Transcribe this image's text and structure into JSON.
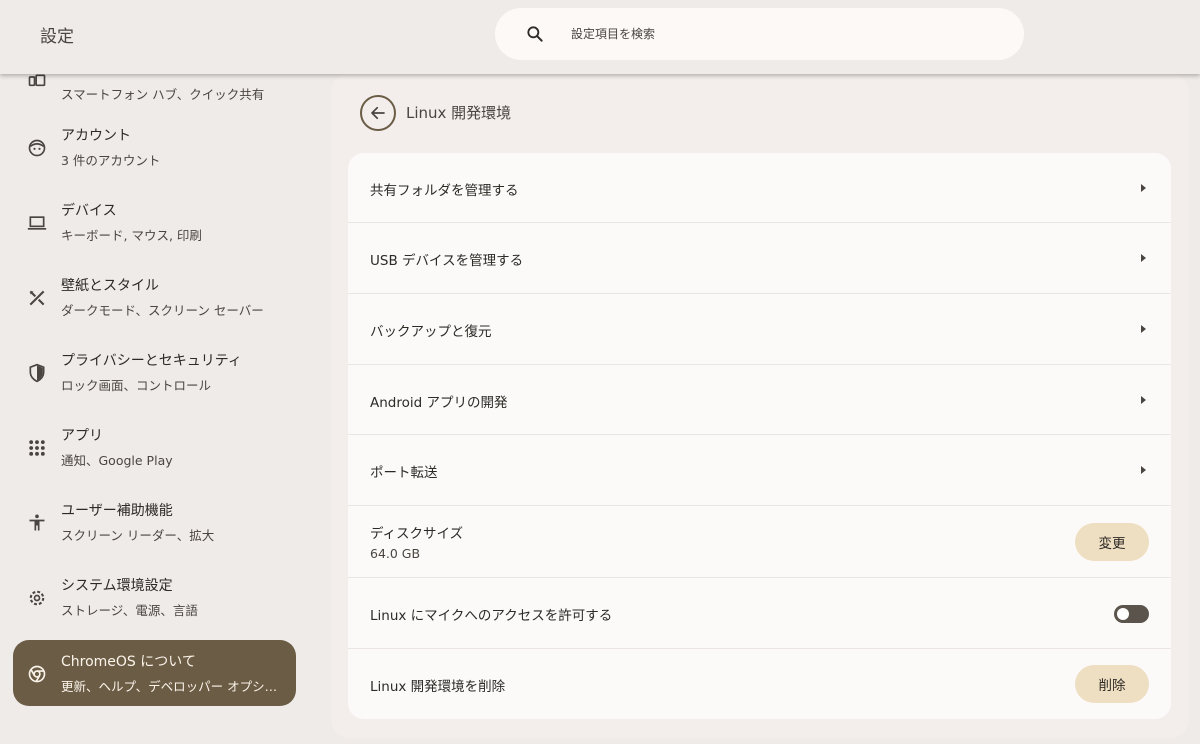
{
  "header": {
    "title": "設定",
    "search": {
      "placeholder": "設定項目を検索",
      "value": ""
    }
  },
  "sidebar": {
    "items": [
      {
        "title": "",
        "subtitle": "スマートフォン ハブ、クイック共有",
        "icon": "devices-icon"
      },
      {
        "title": "アカウント",
        "subtitle": "3 件のアカウント",
        "icon": "face-icon"
      },
      {
        "title": "デバイス",
        "subtitle": "キーボード, マウス, 印刷",
        "icon": "laptop-icon"
      },
      {
        "title": "壁紙とスタイル",
        "subtitle": "ダークモード、スクリーン セーバー",
        "icon": "palette-brush-icon"
      },
      {
        "title": "プライバシーとセキュリティ",
        "subtitle": "ロック画面、コントロール",
        "icon": "shield-icon"
      },
      {
        "title": "アプリ",
        "subtitle": "通知、Google Play",
        "icon": "apps-grid-icon"
      },
      {
        "title": "ユーザー補助機能",
        "subtitle": "スクリーン リーダー、拡大",
        "icon": "accessibility-icon"
      },
      {
        "title": "システム環境設定",
        "subtitle": "ストレージ、電源、言語",
        "icon": "settings-gear-icon"
      },
      {
        "title": "ChromeOS について",
        "subtitle": "更新、ヘルプ、デベロッパー オプション",
        "icon": "chrome-icon",
        "active": true
      }
    ]
  },
  "main": {
    "title": "Linux 開発環境",
    "rows": [
      {
        "label": "共有フォルダを管理する",
        "type": "link"
      },
      {
        "label": "USB デバイスを管理する",
        "type": "link"
      },
      {
        "label": "バックアップと復元",
        "type": "link"
      },
      {
        "label": "Android アプリの開発",
        "type": "link"
      },
      {
        "label": "ポート転送",
        "type": "link"
      },
      {
        "label": "ディスクサイズ",
        "sublabel": "64.0 GB",
        "type": "button",
        "button_label": "変更"
      },
      {
        "label": "Linux にマイクへのアクセスを許可する",
        "type": "toggle",
        "toggle_on": false
      },
      {
        "label": "Linux 開発環境を削除",
        "type": "button",
        "button_label": "削除"
      }
    ]
  },
  "colors": {
    "accent": "#6b5c45",
    "pill_button": "#efdfc2",
    "background": "#efebe9",
    "card": "#fcfaf9"
  }
}
